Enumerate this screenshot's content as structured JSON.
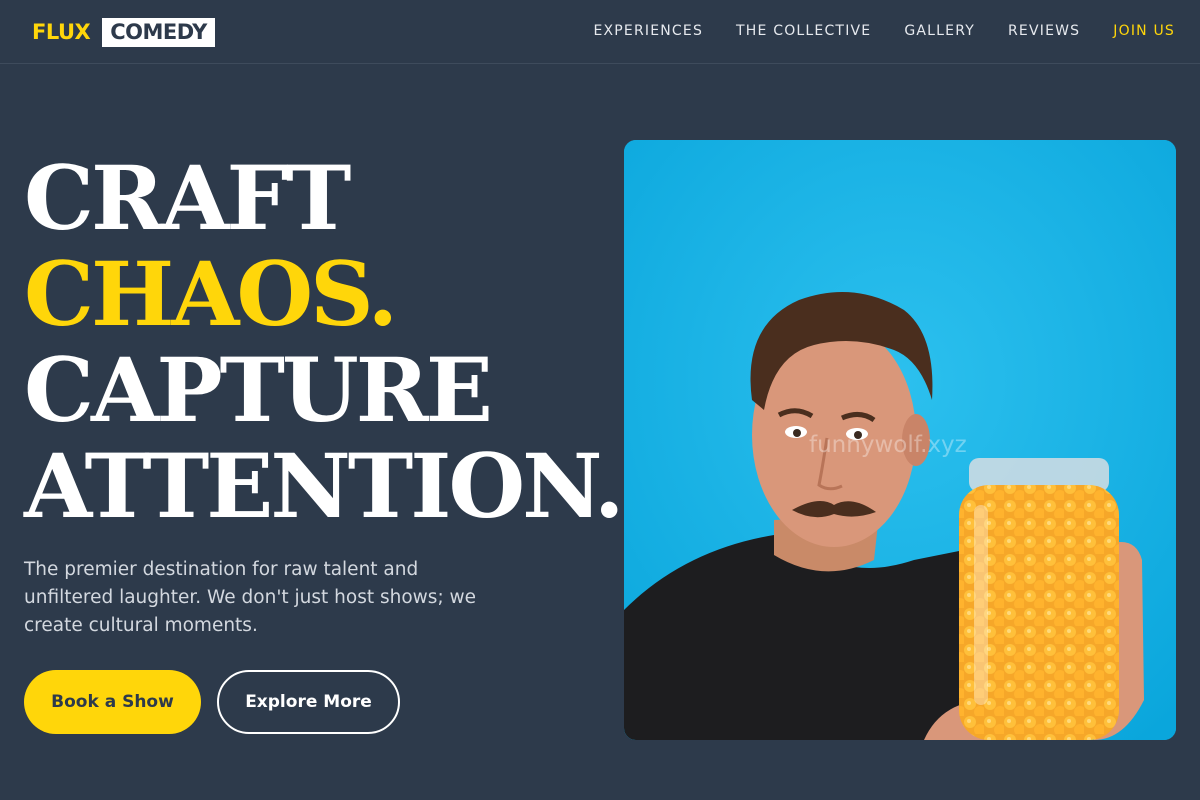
{
  "brand": {
    "word1": "FLUX",
    "word2": "COMEDY"
  },
  "nav": {
    "items": [
      {
        "label": "EXPERIENCES"
      },
      {
        "label": "THE COLLECTIVE"
      },
      {
        "label": "GALLERY"
      },
      {
        "label": "REVIEWS"
      },
      {
        "label": "JOIN US"
      }
    ]
  },
  "hero": {
    "headline": {
      "line1": "CRAFT",
      "line2": "CHAOS.",
      "line3": "CAPTURE",
      "line4": "ATTENTION."
    },
    "subtext": "The premier destination for raw talent and unfiltered laughter. We don't just host shows; we create cultural moments.",
    "primary_button": "Book a Show",
    "secondary_button": "Explore More",
    "image_watermark": "funnywolf.xyz"
  },
  "colors": {
    "background": "#2d3a4b",
    "accent": "#ffd60a",
    "image_background": "#1fb3e6"
  }
}
